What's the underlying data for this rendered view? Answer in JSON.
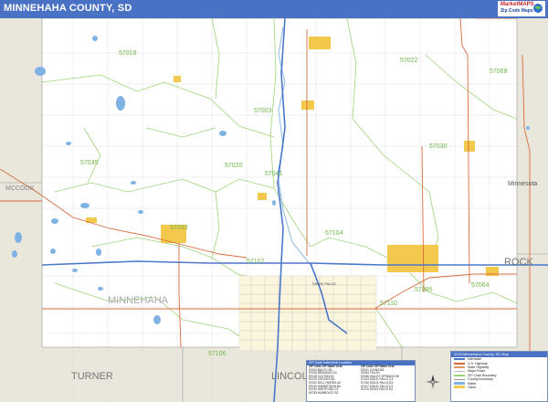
{
  "header": {
    "title": "MINNEHAHA COUNTY, SD",
    "logo_main": "MarketMAPS",
    "logo_sub": "Zip Code Maps"
  },
  "colors": {
    "header_bg": "#4a72c4",
    "land": "#ffffff",
    "outside_county": "#e9e6dc",
    "city_fill": "#f2c94c",
    "water": "#7fb2e5",
    "zip_boundary": "#9ed47a",
    "interstate": "#4a78c8",
    "highway": "#d86b3c"
  },
  "map": {
    "zip_labels": [
      "57018",
      "57022",
      "57003",
      "57020",
      "57035",
      "57041",
      "57033",
      "57005",
      "57064",
      "57104",
      "57107",
      "57110",
      "57068",
      "57106",
      "57030"
    ],
    "place_labels": {
      "mccook": "MCCOOK",
      "minnesota": "Minnesota",
      "rock": "ROCK",
      "minnehaha": "MINNEHAHA",
      "turner": "TURNER",
      "lincoln": "LINCOLN",
      "sioux_falls": "SIOUX FALLS"
    }
  },
  "zip_table": {
    "title": "ZIP Code Index/Unit Location",
    "headers": [
      "ZIP Code",
      "ZIP Name",
      "Grid"
    ],
    "rows": [
      [
        "57003",
        "BALTIC",
        "B3"
      ],
      [
        "57005",
        "BRANDON",
        "D4"
      ],
      [
        "57018",
        "COLTON",
        "A2"
      ],
      [
        "57020",
        "CROOKS",
        "B3"
      ],
      [
        "57022",
        "DELL RAPIDS",
        "A3"
      ],
      [
        "57030",
        "GARRETSON",
        "B4"
      ],
      [
        "57033",
        "HARTFORD",
        "C2"
      ],
      [
        "57035",
        "HUMBOLDT",
        "B2"
      ],
      [
        "57041",
        "LYONS",
        "B3"
      ],
      [
        "57064",
        "TEA",
        "E3"
      ],
      [
        "57068",
        "VALLEY SPRINGS",
        "D5"
      ],
      [
        "57104",
        "SIOUX FALLS",
        "C3"
      ],
      [
        "57106",
        "SIOUX FALLS",
        "D3"
      ],
      [
        "57107",
        "SIOUX FALLS",
        "C3"
      ],
      [
        "57110",
        "SIOUX FALLS",
        "D4"
      ]
    ]
  },
  "legend": {
    "title": "2016 Minnehaha County, SD Map",
    "items": [
      "Interstate",
      "U.S. Highway",
      "State Highway",
      "Major Road",
      "ZIP Code Boundary",
      "County Boundary",
      "Water",
      "Cities"
    ]
  }
}
